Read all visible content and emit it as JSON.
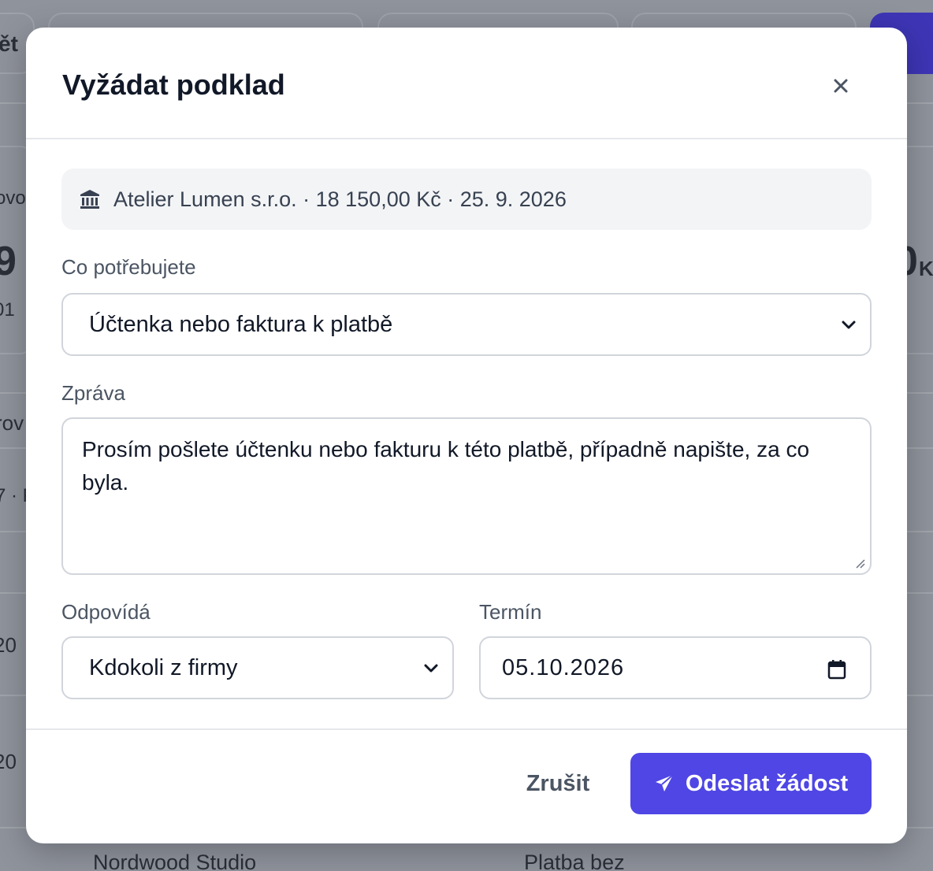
{
  "background": {
    "fragments": [
      "ět",
      "ovo",
      "9",
      "01",
      "rov",
      "7 · P",
      "20",
      "20",
      "0",
      "K",
      "Nordwood Studio",
      "Platba bez"
    ]
  },
  "modal": {
    "title": "Vyžádat podklad",
    "close_icon": "close-icon",
    "info": {
      "icon": "bank-icon",
      "text": "Atelier Lumen s.r.o. · 18 150,00 Kč · 25. 9. 2026"
    },
    "need": {
      "label": "Co potřebujete",
      "selected": "Účtenka nebo faktura k platbě"
    },
    "message": {
      "label": "Zpráva",
      "value": "Prosím pošlete účtenku nebo fakturu k této platbě, případně napište, za co byla."
    },
    "responsible": {
      "label": "Odpovídá",
      "selected": "Kdokoli z firmy"
    },
    "deadline": {
      "label": "Termín",
      "value": "05.10.2026"
    },
    "cancel_label": "Zrušit",
    "submit_label": "Odeslat žádost",
    "accent_color": "#4f46e5"
  }
}
